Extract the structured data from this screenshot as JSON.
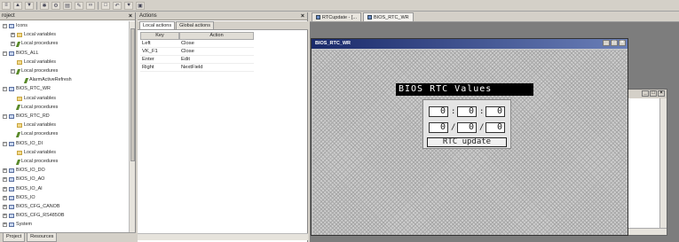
{
  "project_panel": {
    "title": "roject",
    "tree": [
      {
        "label": "Icons",
        "level": 0,
        "icon": "module-icon",
        "expander": "−"
      },
      {
        "label": "Local variables",
        "level": 1,
        "icon": "folder-icon",
        "expander": "+"
      },
      {
        "label": "Local procedures",
        "level": 1,
        "icon": "procedure-icon",
        "expander": "+"
      },
      {
        "label": "BIOS_ALL",
        "level": 0,
        "icon": "module-icon",
        "expander": "−"
      },
      {
        "label": "Local variables",
        "level": 1,
        "icon": "folder-icon",
        "expander": ""
      },
      {
        "label": "Local procedures",
        "level": 1,
        "icon": "procedure-icon",
        "expander": "−"
      },
      {
        "label": "AlarmActiveRefresh",
        "level": 2,
        "icon": "procedure-icon",
        "expander": ""
      },
      {
        "label": "BIOS_RTC_WR",
        "level": 0,
        "icon": "module-icon",
        "expander": "−"
      },
      {
        "label": "Local variables",
        "level": 1,
        "icon": "folder-icon",
        "expander": ""
      },
      {
        "label": "Local procedures",
        "level": 1,
        "icon": "procedure-icon",
        "expander": ""
      },
      {
        "label": "BIOS_RTC_RD",
        "level": 0,
        "icon": "module-icon",
        "expander": "−"
      },
      {
        "label": "Local variables",
        "level": 1,
        "icon": "folder-icon",
        "expander": ""
      },
      {
        "label": "Local procedures",
        "level": 1,
        "icon": "procedure-icon",
        "expander": ""
      },
      {
        "label": "BIOS_IO_DI",
        "level": 0,
        "icon": "module-icon",
        "expander": "−"
      },
      {
        "label": "Local variables",
        "level": 1,
        "icon": "folder-icon",
        "expander": ""
      },
      {
        "label": "Local procedures",
        "level": 1,
        "icon": "procedure-icon",
        "expander": ""
      },
      {
        "label": "BIOS_IO_DO",
        "level": 0,
        "icon": "module-icon",
        "expander": "+"
      },
      {
        "label": "BIOS_IO_AO",
        "level": 0,
        "icon": "module-icon",
        "expander": "+"
      },
      {
        "label": "BIOS_IO_AI",
        "level": 0,
        "icon": "module-icon",
        "expander": "+"
      },
      {
        "label": "BIOS_IO",
        "level": 0,
        "icon": "module-icon",
        "expander": "+"
      },
      {
        "label": "BIOS_CFG_CANOB",
        "level": 0,
        "icon": "module-icon",
        "expander": "+"
      },
      {
        "label": "BIOS_CFG_RS485OB",
        "level": 0,
        "icon": "module-icon",
        "expander": "+"
      },
      {
        "label": "System",
        "level": 0,
        "icon": "module-icon",
        "expander": "+"
      }
    ],
    "bottom_tabs": [
      "Project",
      "Resources"
    ]
  },
  "actions_panel": {
    "title": "Actions",
    "tabs": [
      "Local actions",
      "Global actions"
    ],
    "columns": [
      "Key",
      "Action"
    ],
    "rows": [
      {
        "key": "Left",
        "action": "Close"
      },
      {
        "key": "VK_F1",
        "action": "Close"
      },
      {
        "key": "Enter",
        "action": "Edit"
      },
      {
        "key": "Right",
        "action": "NextField"
      }
    ]
  },
  "editor": {
    "doc_tabs": [
      "RTCupdate - [...",
      "BIOS_RTC_WR"
    ],
    "front_window_title": "BIOS_RTC_WR",
    "window_buttons": [
      "_",
      "□",
      "×"
    ]
  },
  "rtc_dialog": {
    "heading": "BIOS RTC Values",
    "time": [
      "0",
      "0",
      "0"
    ],
    "time_sep": ":",
    "date": [
      "0",
      "0",
      "0"
    ],
    "date_sep": "/",
    "button_label": "RTC update"
  },
  "colors": {
    "title_bar": "#1a2a6a",
    "rtc_heading_bg": "#000000"
  }
}
